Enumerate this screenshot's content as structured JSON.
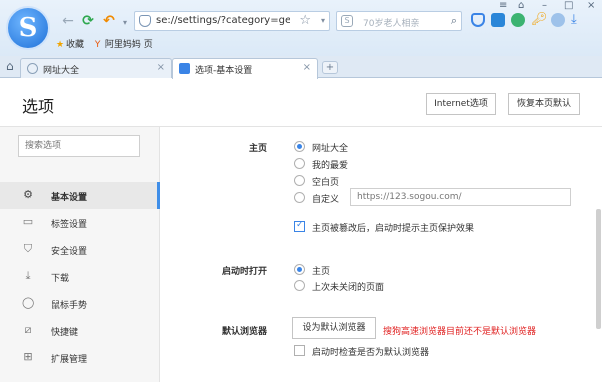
{
  "browser": {
    "address": "se://settings/?category=gen",
    "search_placeholder": "70岁老人相亲",
    "bookmarks": [
      "收藏",
      "阿里妈妈 页"
    ],
    "tabs": [
      {
        "label": "网址大全"
      },
      {
        "label": "选项-基本设置"
      }
    ],
    "new_tab_symbol": "+"
  },
  "page": {
    "title": "选项",
    "buttons": {
      "internet": "Internet选项",
      "reset": "恢复本页默认"
    }
  },
  "sidebar": {
    "search_placeholder": "搜索选项",
    "items": [
      {
        "label": "基本设置",
        "icon": "gear-icon"
      },
      {
        "label": "标签设置",
        "icon": "tab-icon"
      },
      {
        "label": "安全设置",
        "icon": "shield-icon"
      },
      {
        "label": "下载",
        "icon": "download-icon"
      },
      {
        "label": "鼠标手势",
        "icon": "mouse-icon"
      },
      {
        "label": "快捷键",
        "icon": "shortcut-icon"
      },
      {
        "label": "扩展管理",
        "icon": "extension-icon"
      }
    ]
  },
  "settings": {
    "homepage": {
      "label": "主页",
      "options": [
        "网址大全",
        "我的最爱",
        "空白页",
        "自定义"
      ],
      "custom_url": "https://123.sogou.com/",
      "protect_label": "主页被篡改后，启动时提示主页保护效果"
    },
    "startup": {
      "label": "启动时打开",
      "options": [
        "主页",
        "上次未关闭的页面"
      ]
    },
    "default_browser": {
      "label": "默认浏览器",
      "button": "设为默认浏览器",
      "warning": "搜狗高速浏览器目前还不是默认浏览器",
      "check_label": "启动时检查是否为默认浏览器"
    }
  },
  "colors": {
    "accent": "#3a84e6",
    "warning": "#e02020"
  }
}
